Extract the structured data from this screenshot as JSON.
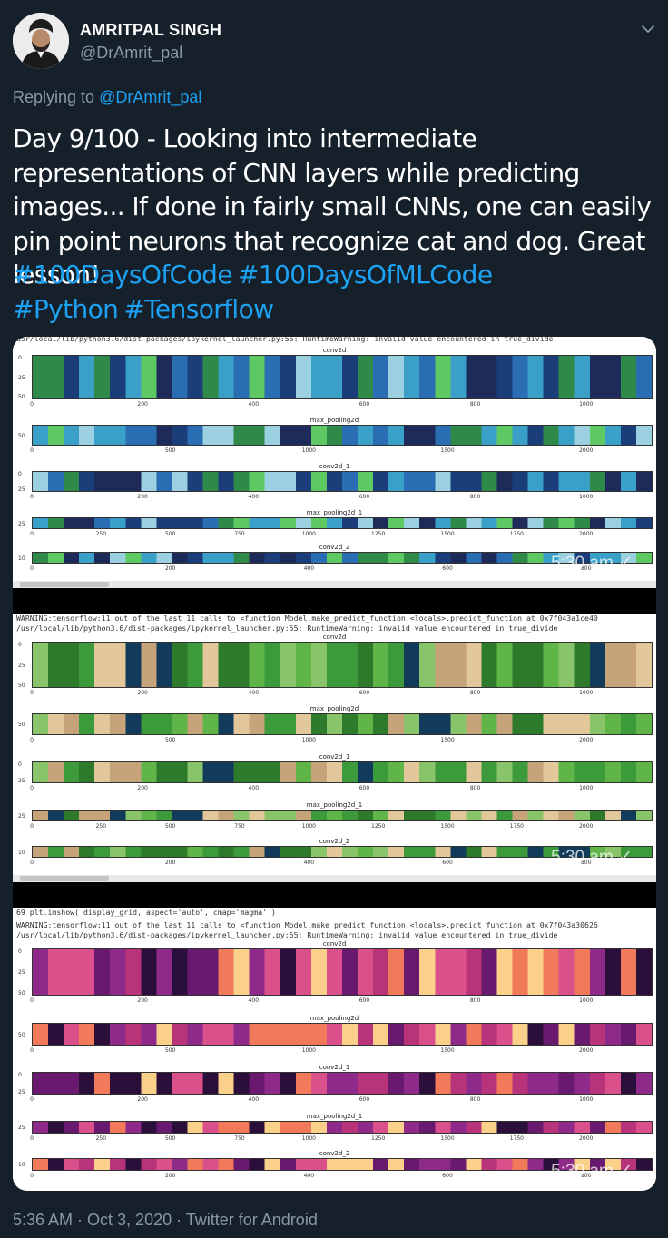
{
  "author": {
    "name": "AMRITPAL SINGH",
    "handle": "@DrAmrit_pal",
    "avatar_icon": "person-avatar"
  },
  "reply": {
    "prefix": "Replying to",
    "to": "@DrAmrit_pal"
  },
  "tweet": {
    "text": "Day 9/100 - Looking into intermediate representations of CNN layers while predicting images... If done in fairly small CNNs, one can easily pin point neurons  that recognize cat and dog. Great lesson!",
    "hashtags": [
      "#100DaysOfCode",
      "#100DaysOfMLCode",
      "#Python",
      "#Tensorflow"
    ]
  },
  "media": {
    "screenshots": [
      {
        "lines": [
          "usr/local/lib/python3.6/dist-packages/ipykernel_launcher.py:55: RuntimeWarning: invalid value encountered in true_divide"
        ],
        "timestamp": "5:30 am ✓",
        "palette": "viridis-blue",
        "plots": [
          {
            "title": "conv2d",
            "ticks": [
              "0",
              "200",
              "400",
              "600",
              "800",
              "1000"
            ],
            "yticks": [
              "0",
              "25",
              "50"
            ]
          },
          {
            "title": "max_pooling2d",
            "ticks": [
              "0",
              "500",
              "1000",
              "1500",
              "2000"
            ],
            "yticks": [
              "50"
            ]
          },
          {
            "title": "conv2d_1",
            "ticks": [
              "0",
              "200",
              "400",
              "600",
              "800",
              "1000"
            ],
            "yticks": [
              "0",
              "25"
            ]
          },
          {
            "title": "max_pooling2d_1",
            "ticks": [
              "0",
              "250",
              "500",
              "750",
              "1000",
              "1250",
              "1500",
              "1750",
              "2000"
            ],
            "yticks": [
              "25"
            ]
          },
          {
            "title": "conv2d_2",
            "ticks": [
              "0",
              "200",
              "400",
              "600",
              "800"
            ],
            "yticks": [
              "10"
            ]
          }
        ]
      },
      {
        "lines": [
          "WARNING:tensorflow:11 out of the last 11 calls to <function Model.make_predict_function.<locals>.predict_function at 0x7f043a1ce40",
          "/usr/local/lib/python3.6/dist-packages/ipykernel_launcher.py:55: RuntimeWarning: invalid value encountered in true_divide"
        ],
        "timestamp": "5:30 am ✓",
        "palette": "viridis-green",
        "plots": [
          {
            "title": "conv2d",
            "ticks": [
              "0",
              "200",
              "400",
              "600",
              "800",
              "1000"
            ],
            "yticks": [
              "0",
              "25",
              "50"
            ]
          },
          {
            "title": "max_pooling2d",
            "ticks": [
              "0",
              "500",
              "1000",
              "1500",
              "2000"
            ],
            "yticks": [
              "50"
            ]
          },
          {
            "title": "conv2d_1",
            "ticks": [
              "0",
              "200",
              "400",
              "600",
              "800",
              "1000"
            ],
            "yticks": [
              "0",
              "25"
            ]
          },
          {
            "title": "max_pooling2d_1",
            "ticks": [
              "0",
              "250",
              "500",
              "750",
              "1000",
              "1250",
              "1500",
              "1750",
              "2000"
            ],
            "yticks": [
              "25"
            ]
          },
          {
            "title": "conv2d_2",
            "ticks": [
              "0",
              "200",
              "400",
              "600",
              "800"
            ],
            "yticks": [
              "10"
            ]
          }
        ]
      },
      {
        "lines": [
          "69      plt.imshow( display_grid, aspect='auto', cmap='magma' )",
          "WARNING:tensorflow:11 out of the last 11 calls to <function Model.make_predict_function.<locals>.predict_function at 0x7f043a30626",
          "/usr/local/lib/python3.6/dist-packages/ipykernel_launcher.py:55: RuntimeWarning: invalid value encountered in true_divide"
        ],
        "timestamp": "5:30 am ✓",
        "palette": "magma",
        "plots": [
          {
            "title": "conv2d",
            "ticks": [
              "0",
              "200",
              "400",
              "600",
              "800",
              "1000"
            ],
            "yticks": [
              "0",
              "25",
              "50"
            ]
          },
          {
            "title": "max_pooling2d",
            "ticks": [
              "0",
              "500",
              "1000",
              "1500",
              "2000"
            ],
            "yticks": [
              "50"
            ]
          },
          {
            "title": "conv2d_1",
            "ticks": [
              "0",
              "200",
              "400",
              "600",
              "800",
              "1000"
            ],
            "yticks": [
              "0",
              "25"
            ]
          },
          {
            "title": "max_pooling2d_1",
            "ticks": [
              "0",
              "250",
              "500",
              "750",
              "1000",
              "1250",
              "1500",
              "1750",
              "2000"
            ],
            "yticks": [
              "25"
            ]
          },
          {
            "title": "conv2d_2",
            "ticks": [
              "0",
              "200",
              "400",
              "600",
              "800"
            ],
            "yticks": [
              "10"
            ]
          }
        ]
      }
    ]
  },
  "footer": {
    "meta": "5:36 AM · Oct 3, 2020 · Twitter for Android"
  },
  "colors": {
    "background": "#15202b",
    "secondary_text": "#8899a6",
    "link": "#1da1f2"
  }
}
